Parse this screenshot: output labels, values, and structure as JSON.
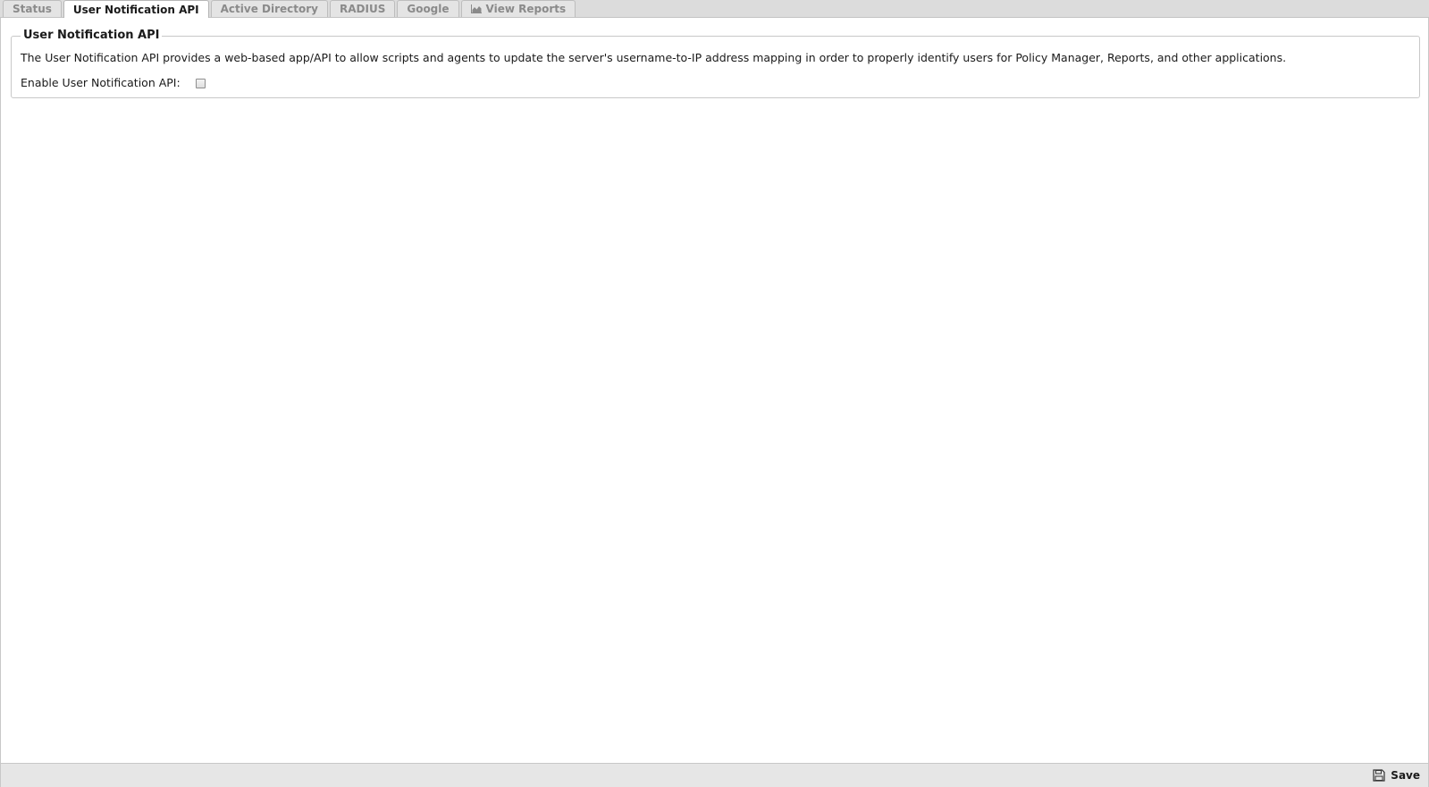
{
  "tabs": [
    {
      "label": "Status",
      "active": false
    },
    {
      "label": "User Notification API",
      "active": true
    },
    {
      "label": "Active Directory",
      "active": false
    },
    {
      "label": "RADIUS",
      "active": false
    },
    {
      "label": "Google",
      "active": false
    },
    {
      "label": "View Reports",
      "active": false,
      "icon": "area-chart-icon"
    }
  ],
  "section": {
    "legend": "User Notification API",
    "description": "The User Notification API provides a web-based app/API to allow scripts and agents to update the server's username-to-IP address mapping in order to properly identify users for Policy Manager, Reports, and other applications.",
    "enable_label": "Enable User Notification API:",
    "enable_checked": false
  },
  "toolbar": {
    "save_label": "Save",
    "save_icon": "floppy-disk-icon"
  },
  "colors": {
    "tabbar_bg": "#dcdcdc",
    "active_tab_bg": "#ffffff",
    "inactive_tab_text": "#8a8a8a",
    "border": "#c8c8c8",
    "toolbar_bg": "#e6e6e6"
  }
}
